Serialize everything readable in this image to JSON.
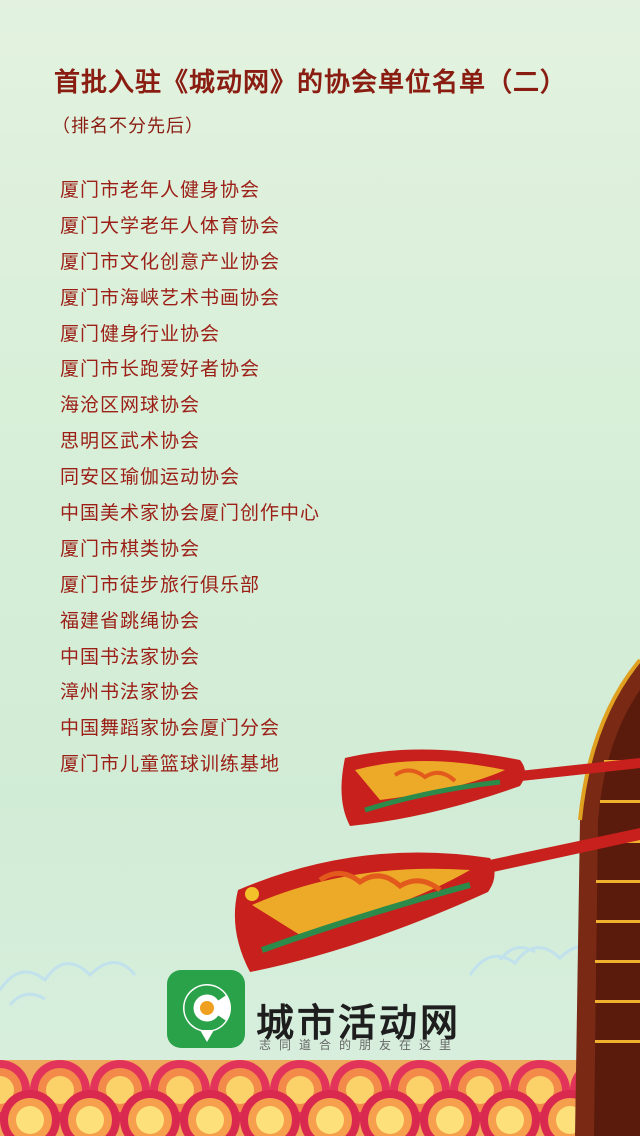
{
  "header": {
    "title": "首批入驻《城动网》的协会单位名单（二）",
    "subtitle": "（排名不分先后）"
  },
  "associations": [
    "厦门市老年人健身协会",
    "厦门大学老年人体育协会",
    "厦门市文化创意产业协会",
    "厦门市海峡艺术书画协会",
    "厦门健身行业协会",
    "厦门市长跑爱好者协会",
    "海沧区网球协会",
    "思明区武术协会",
    "同安区瑜伽运动协会",
    "中国美术家协会厦门创作中心",
    "厦门市棋类协会",
    "厦门市徒步旅行俱乐部",
    "福建省跳绳协会",
    "中国书法家协会",
    "漳州书法家协会",
    "中国舞蹈家协会厦门分会",
    "厦门市儿童篮球训练基地"
  ],
  "footer": {
    "brand": "城市活动网",
    "slogan": "志同道合的朋友在这里"
  },
  "colors": {
    "title": "#8a1d12",
    "list_text": "#9b1f16",
    "logo_green": "#2aa24a",
    "logo_orange": "#f0a020",
    "oar_red": "#c8201c",
    "boat_brown": "#7a2a14"
  }
}
